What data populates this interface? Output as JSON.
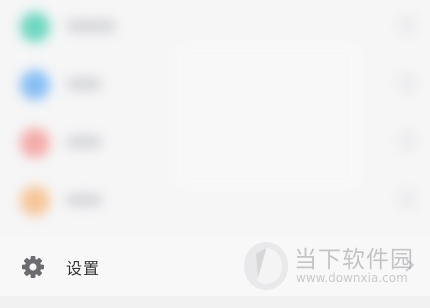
{
  "menu": {
    "blurred_items": [
      {
        "icon": "teal-circle-icon",
        "color": "#5fd3b9"
      },
      {
        "icon": "blue-circle-icon",
        "color": "#7ab8f5"
      },
      {
        "icon": "red-circle-icon",
        "color": "#f4a3a0"
      },
      {
        "icon": "orange-circle-icon",
        "color": "#f7c08f"
      }
    ],
    "settings": {
      "label": "设置",
      "icon": "gear-icon"
    }
  },
  "watermark": {
    "name": "当下软件园",
    "url": "www.downxia.com"
  },
  "colors": {
    "background": "#f6f6f7",
    "text": "#333333",
    "icon": "#6b6b70"
  }
}
